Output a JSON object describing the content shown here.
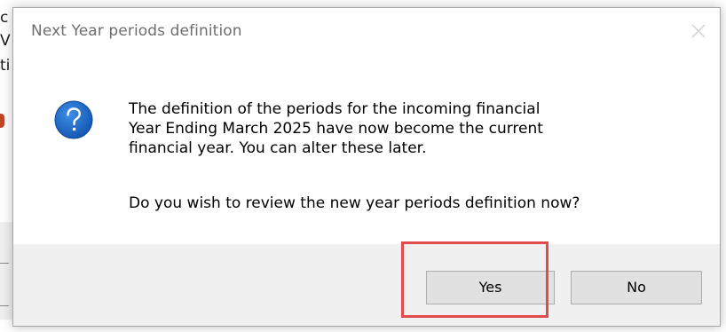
{
  "background": {
    "fragments": [
      "c",
      "V",
      "ti"
    ]
  },
  "dialog": {
    "title": "Next Year periods definition",
    "close_icon": "close-icon",
    "question_icon": "question-icon",
    "message_lines": [
      "The definition of the periods for the incoming financial",
      "Year Ending March 2025 have now become the current",
      "financial year. You can alter these later."
    ],
    "question": "Do you wish to review the new year periods definition now?",
    "buttons": {
      "yes": "Yes",
      "no": "No"
    }
  },
  "colors": {
    "icon_blue": "#1f65c2",
    "highlight": "#e04b4b",
    "footer": "#f0f0f0"
  }
}
